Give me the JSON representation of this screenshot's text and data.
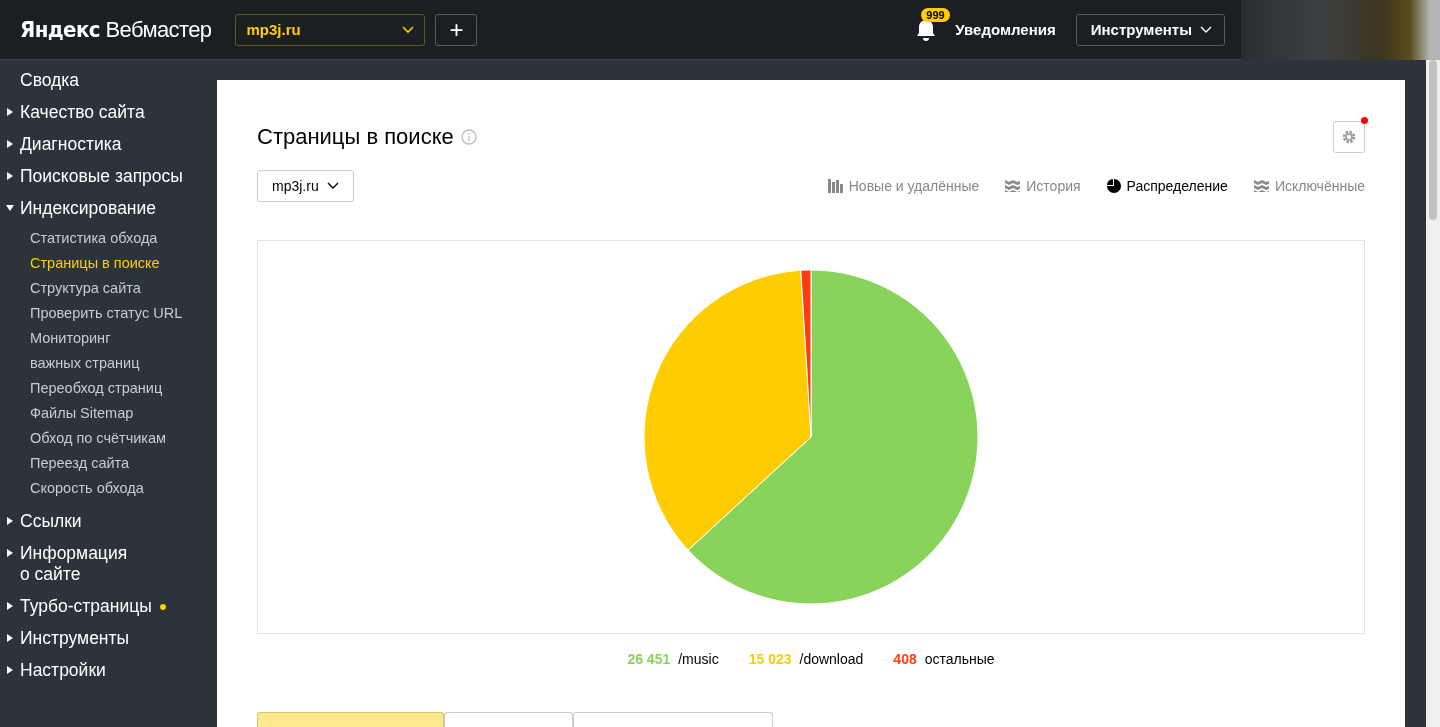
{
  "header": {
    "logo_brand": "Яндекс",
    "logo_product": "Вебмастер",
    "site_select": "mp3j.ru",
    "add_button": "+",
    "notifications": {
      "badge": "999",
      "label": "Уведомления"
    },
    "tools_menu": "Инструменты"
  },
  "sidebar": {
    "items": [
      {
        "label": "Сводка",
        "kind": "link"
      },
      {
        "label": "Качество сайта",
        "kind": "group",
        "expanded": false
      },
      {
        "label": "Диагностика",
        "kind": "group",
        "expanded": false
      },
      {
        "label": "Поисковые запросы",
        "kind": "group",
        "expanded": false
      },
      {
        "label": "Индексирование",
        "kind": "group",
        "expanded": true,
        "children": [
          {
            "label": "Статистика обхода",
            "selected": false
          },
          {
            "label": "Страницы в поиске",
            "selected": true
          },
          {
            "label": "Структура сайта",
            "selected": false
          },
          {
            "label": "Проверить статус URL",
            "selected": false
          },
          {
            "label": "Мониторинг\nважных страниц",
            "selected": false
          },
          {
            "label": "Переобход страниц",
            "selected": false
          },
          {
            "label": "Файлы Sitemap",
            "selected": false
          },
          {
            "label": "Обход по счётчикам",
            "selected": false
          },
          {
            "label": "Переезд сайта",
            "selected": false
          },
          {
            "label": "Скорость обхода",
            "selected": false
          }
        ]
      },
      {
        "label": "Ссылки",
        "kind": "group",
        "expanded": false
      },
      {
        "label": "Информация\nо сайте",
        "kind": "group",
        "expanded": false
      },
      {
        "label": "Турбо-страницы",
        "kind": "group",
        "expanded": false,
        "dot": true
      },
      {
        "label": "Инструменты",
        "kind": "group",
        "expanded": false
      },
      {
        "label": "Настройки",
        "kind": "group",
        "expanded": false
      }
    ]
  },
  "page": {
    "title": "Страницы в поиске",
    "settings_dot": true,
    "host_select": "mp3j.ru",
    "views": [
      {
        "label": "Новые и удалённые",
        "kind": "bars",
        "selected": false
      },
      {
        "label": "История",
        "kind": "layers",
        "selected": false
      },
      {
        "label": "Распределение",
        "kind": "pie",
        "selected": true
      },
      {
        "label": "Исключённые",
        "kind": "layers",
        "selected": false
      }
    ],
    "chart_data": {
      "type": "pie",
      "categories": [
        "/music",
        "/download",
        "остальные"
      ],
      "series": [
        {
          "values": [
            63.16,
            35.87,
            0.97
          ]
        }
      ],
      "value_labels": [
        "26 451",
        "15 023",
        "408"
      ],
      "colors": [
        "#88d45a",
        "#ffcc00",
        "#ff3b12"
      ]
    },
    "bottom_tabs": [
      {
        "selected": true
      },
      {
        "selected": false
      },
      {
        "selected": false
      }
    ]
  }
}
